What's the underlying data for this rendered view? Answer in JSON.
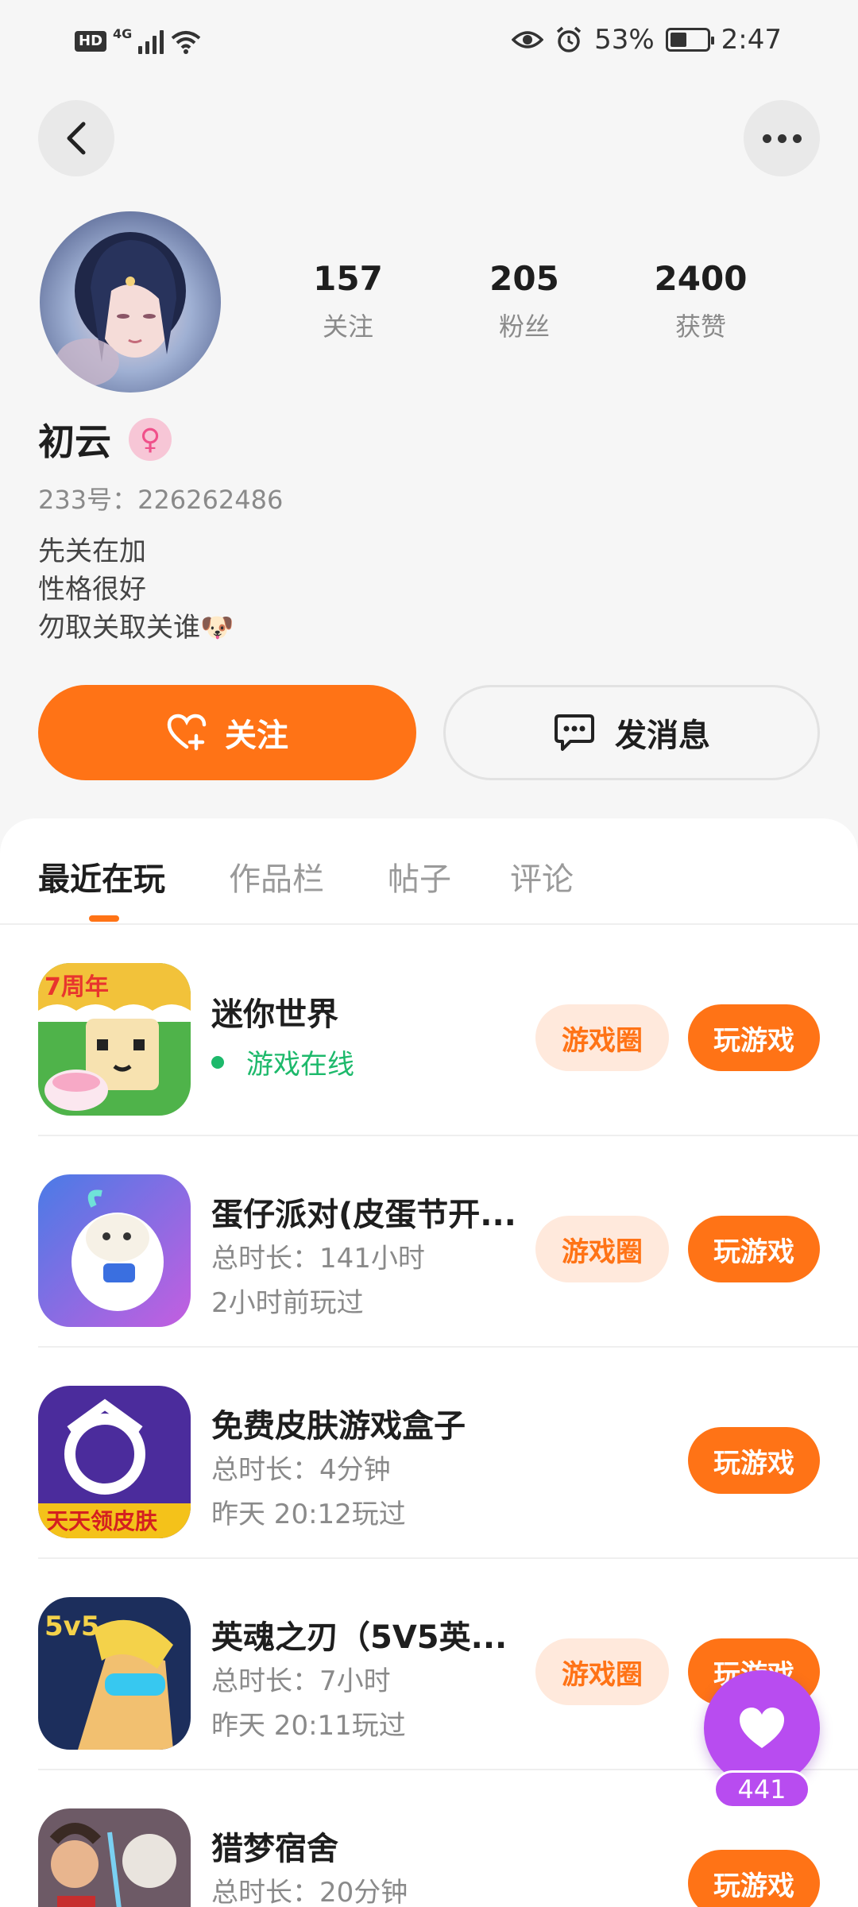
{
  "status_bar": {
    "hd": "HD",
    "network": "4G",
    "battery": "53%",
    "time": "2:47",
    "icons": [
      "signal-icon",
      "wifi-icon",
      "eye-icon",
      "alarm-icon",
      "battery-icon"
    ]
  },
  "header": {
    "back_icon": "chevron-left-icon",
    "more_icon": "more-dots-icon"
  },
  "profile": {
    "name": "初云",
    "gender_symbol": "♀",
    "uid": "233号：226262486",
    "bio": [
      "先关在加",
      "性格很好",
      "勿取关取关谁🐶"
    ],
    "stats": [
      {
        "value": "157",
        "label": "关注"
      },
      {
        "value": "205",
        "label": "粉丝"
      },
      {
        "value": "2400",
        "label": "获赞"
      }
    ]
  },
  "actions": {
    "follow": "关注",
    "message": "发消息"
  },
  "tabs": [
    {
      "label": "最近在玩",
      "active": true
    },
    {
      "label": "作品栏",
      "active": false
    },
    {
      "label": "帖子",
      "active": false
    },
    {
      "label": "评论",
      "active": false
    }
  ],
  "games": [
    {
      "title": "迷你世界",
      "status": "游戏在线",
      "circle": "游戏圈",
      "play": "玩游戏"
    },
    {
      "title": "蛋仔派对(皮蛋节开...",
      "duration": "总时长：141小时",
      "last_played": "2小时前玩过",
      "circle": "游戏圈",
      "play": "玩游戏"
    },
    {
      "title": "免费皮肤游戏盒子",
      "duration": "总时长：4分钟",
      "last_played": "昨天 20:12玩过",
      "play": "玩游戏"
    },
    {
      "title": "英魂之刃（5V5英...",
      "duration": "总时长：7小时",
      "last_played": "昨天 20:11玩过",
      "circle": "游戏圈",
      "play": "玩游戏"
    },
    {
      "title": "猎梦宿舍",
      "duration": "总时长：20分钟",
      "play": "玩游戏"
    }
  ],
  "floating_like": {
    "count": "441",
    "icon": "heart-icon"
  },
  "colors": {
    "accent": "#ff7316",
    "accent_light": "#ffe9dc",
    "online": "#1db96b",
    "like": "#b84cf0"
  }
}
